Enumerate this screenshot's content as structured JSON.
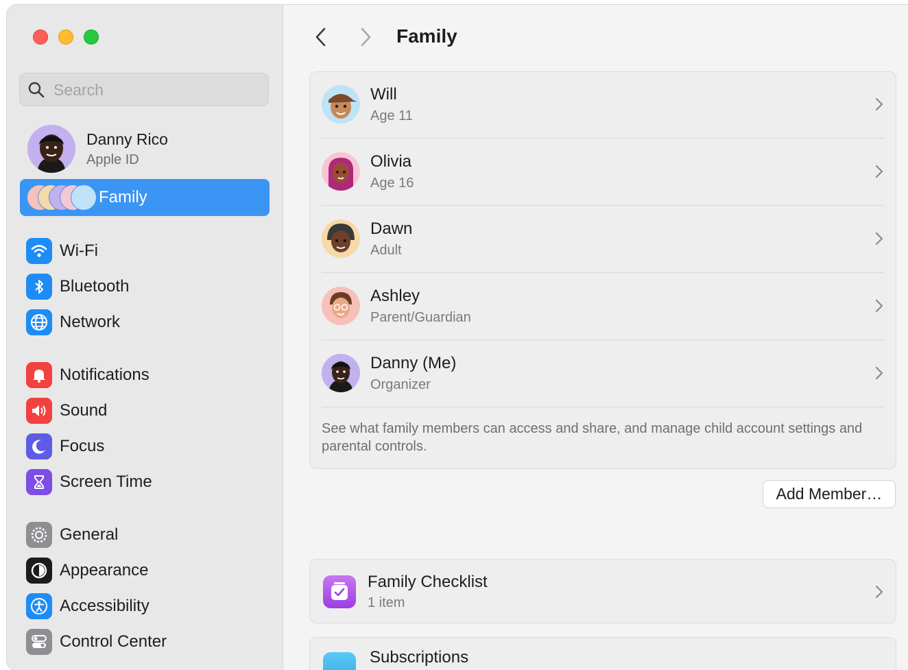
{
  "window": {
    "controls": [
      "close",
      "minimize",
      "zoom"
    ]
  },
  "sidebar": {
    "search_placeholder": "Search",
    "profile": {
      "name": "Danny Rico",
      "subtitle": "Apple ID"
    },
    "family_label": "Family",
    "groups": [
      [
        {
          "label": "Wi-Fi",
          "icon": "wifi-icon",
          "color": "#1e8cf5"
        },
        {
          "label": "Bluetooth",
          "icon": "bluetooth-icon",
          "color": "#1e8cf5"
        },
        {
          "label": "Network",
          "icon": "globe-icon",
          "color": "#1e8cf5"
        }
      ],
      [
        {
          "label": "Notifications",
          "icon": "bell-icon",
          "color": "#f2413e"
        },
        {
          "label": "Sound",
          "icon": "speaker-icon",
          "color": "#f2413e"
        },
        {
          "label": "Focus",
          "icon": "moon-icon",
          "color": "#5e5ce6"
        },
        {
          "label": "Screen Time",
          "icon": "hourglass-icon",
          "color": "#7d4de6"
        }
      ],
      [
        {
          "label": "General",
          "icon": "gear-icon",
          "color": "#8e8e93"
        },
        {
          "label": "Appearance",
          "icon": "appearance-icon",
          "color": "#1c1c1e"
        },
        {
          "label": "Accessibility",
          "icon": "accessibility-icon",
          "color": "#1e8cf5"
        },
        {
          "label": "Control Center",
          "icon": "control-center-icon",
          "color": "#8e8e93"
        }
      ]
    ]
  },
  "main": {
    "title": "Family",
    "members": [
      {
        "name": "Will",
        "role": "Age 11",
        "avatar_bg": "#bfe3f6",
        "skin": "#c48a5c",
        "hair": "#7a4a2a"
      },
      {
        "name": "Olivia",
        "role": "Age 16",
        "avatar_bg": "#f7c6d4",
        "skin": "#9b4d33",
        "hair": "#b0287a"
      },
      {
        "name": "Dawn",
        "role": "Adult",
        "avatar_bg": "#f6d9a6",
        "skin": "#6b3f2a",
        "hair": "#3a3a3a"
      },
      {
        "name": "Ashley",
        "role": "Parent/Guardian",
        "avatar_bg": "#f7c0bb",
        "skin": "#e8a889",
        "hair": "#6b3c22"
      },
      {
        "name": "Danny (Me)",
        "role": "Organizer",
        "avatar_bg": "#c3b0ee",
        "skin": "#3a2218",
        "hair": "#111111"
      }
    ],
    "description": "See what family members can access and share, and manage child account settings and parental controls.",
    "add_member_label": "Add Member…",
    "checklist": {
      "title": "Family Checklist",
      "subtitle": "1 item"
    },
    "subscriptions": {
      "title": "Subscriptions"
    }
  }
}
